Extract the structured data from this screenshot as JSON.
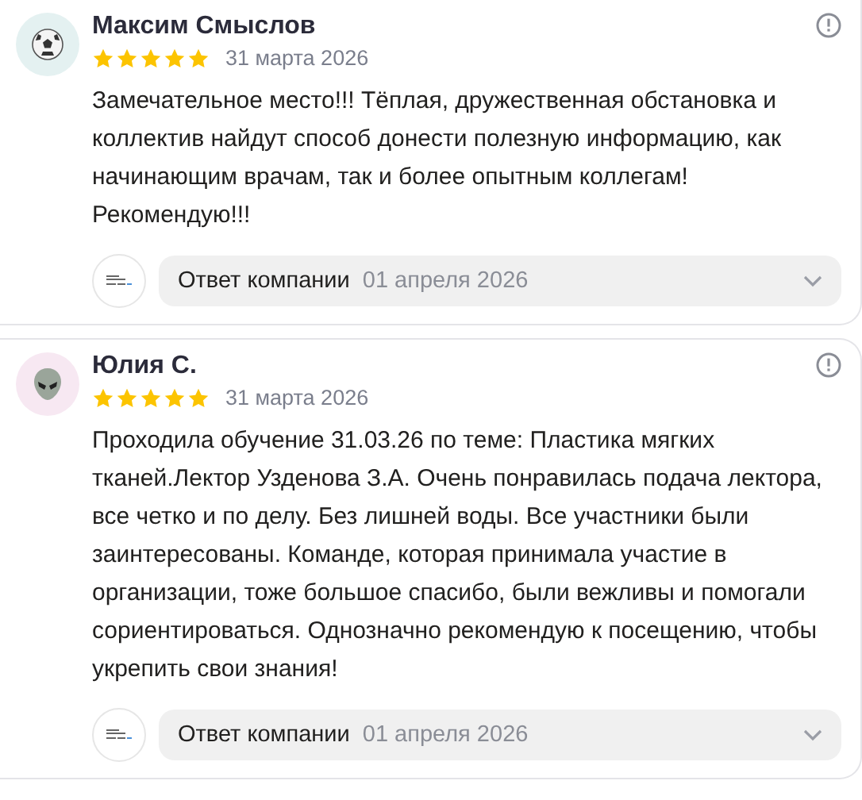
{
  "reviews": [
    {
      "author": "Максим Смыслов",
      "avatar": {
        "kind": "ball"
      },
      "stars": 5,
      "date": "31 марта 2026",
      "text": "Замечательное место!!! Тёплая, дружественная обстановка и коллектив найдут способ донести полезную информацию, как начинающим врачам, так и более опытным коллегам! Рекомендую!!!",
      "reply": {
        "label": "Ответ компании",
        "date": "01 апреля 2026",
        "expanded": false
      }
    },
    {
      "author": "Юлия С.",
      "avatar": {
        "kind": "alien"
      },
      "stars": 5,
      "date": "31 марта 2026",
      "text": "Проходила обучение 31.03.26 по теме: Пластика мягких тканей.Лектор Узденова З.А. Очень понравилась подача лектора, все четко и по делу. Без лишней воды. Все участники были заинтересованы. Команде, которая принимала участие в организации, тоже большое спасибо, были вежливы и помогали сориентироваться. Однозначно рекомендую к посещению, чтобы укрепить свои знания!",
      "reply": {
        "label": "Ответ компании",
        "date": "01 апреля 2026",
        "expanded": false
      }
    }
  ]
}
